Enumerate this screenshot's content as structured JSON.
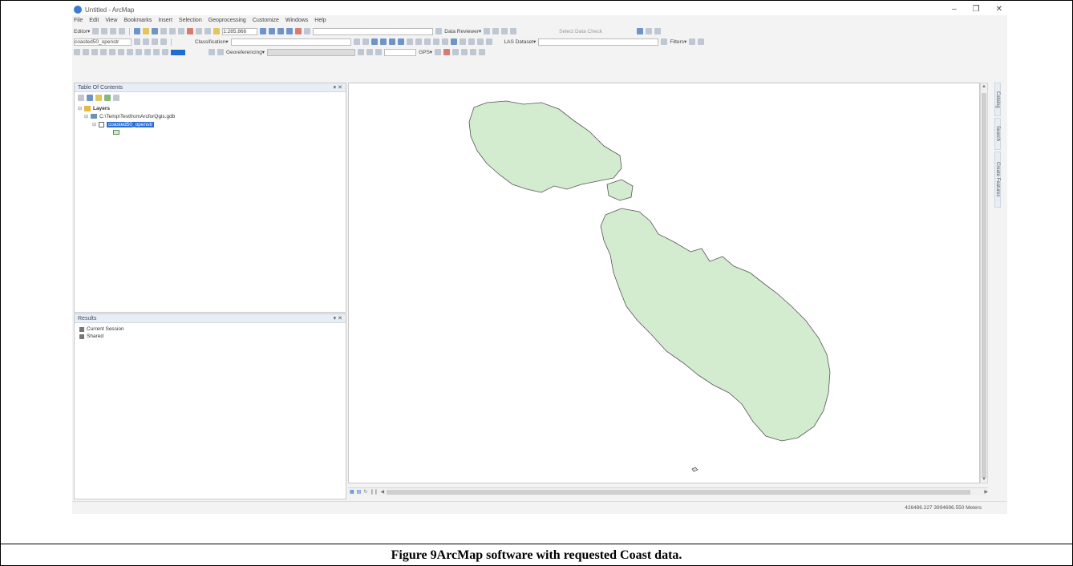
{
  "caption": "Figure 9ArcMap software with requested Coast data.",
  "window": {
    "title": "Untitled - ArcMap",
    "controls": [
      "–",
      "❐",
      "✕"
    ]
  },
  "menu": [
    "File",
    "Edit",
    "View",
    "Bookmarks",
    "Insert",
    "Selection",
    "Geoprocessing",
    "Customize",
    "Windows",
    "Help"
  ],
  "toolbar": {
    "editor": "Editor▾",
    "scale": "1:285,866",
    "data_reviewer": "Data Reviewer▾",
    "select_data_check": "Select Data Check",
    "layer_select": "coasted50_openstr",
    "classification": "Classification▾",
    "las_dataset": "LAS Dataset▾",
    "filters": "Filters▾",
    "georeferencing": "Georeferencing▾",
    "gps": "GPS▾"
  },
  "toc": {
    "title": "Table Of Contents",
    "layers_label": "Layers",
    "gdb_path": "C:\\Temp\\TestfromArcforQgis.gdb",
    "layer_name": "coasted50_openstr"
  },
  "results": {
    "title": "Results",
    "items": [
      "Current Session",
      "Shared"
    ]
  },
  "side_tabs": [
    "Catalog",
    "Search",
    "Create Features"
  ],
  "status": {
    "coordinates": "426486.227  3994696.550 Meters"
  },
  "map": {
    "land_fill": "#d3ecd0",
    "land_stroke": "#555555"
  }
}
